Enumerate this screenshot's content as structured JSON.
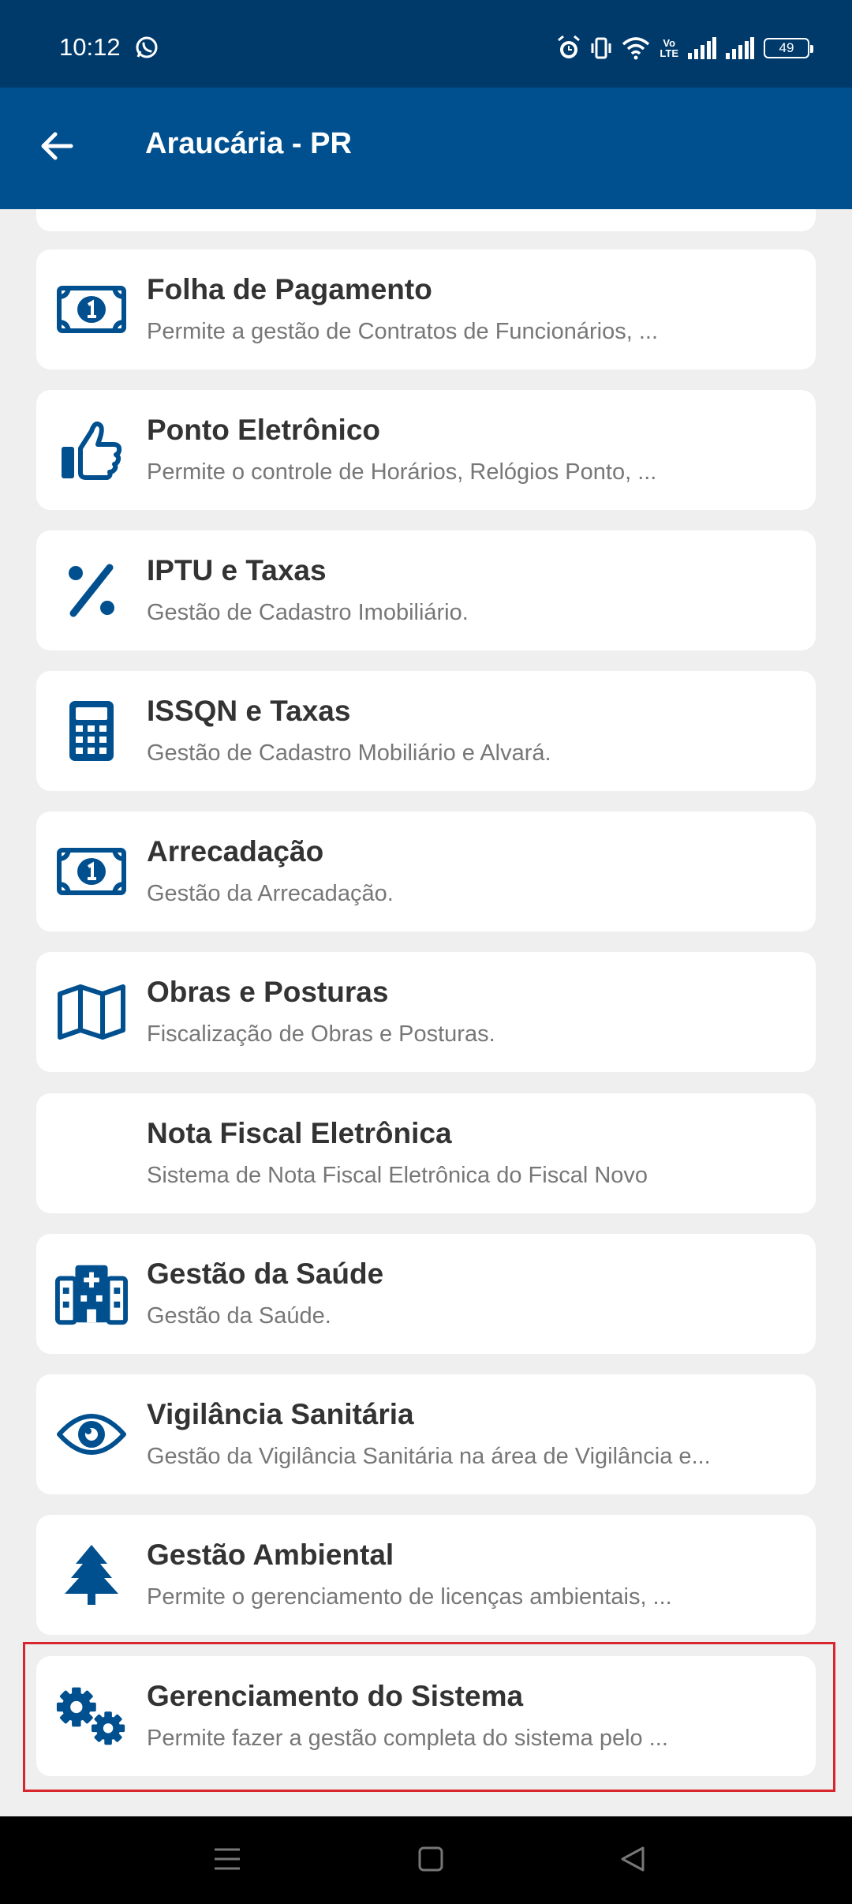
{
  "status_bar": {
    "time": "10:12",
    "battery": "49"
  },
  "app_bar": {
    "title": "Araucária - PR",
    "back_icon": "arrow-left-icon"
  },
  "colors": {
    "status_bar": "#003a6b",
    "app_bar": "#00508f",
    "icon": "#00508f",
    "highlight": "#d9262e",
    "background": "#efefef"
  },
  "modules": [
    {
      "title": "Folha de Pagamento",
      "desc": "Permite a gestão de Contratos de Funcionários, ...",
      "icon": "money-bill-icon"
    },
    {
      "title": "Ponto Eletrônico",
      "desc": "Permite o controle de Horários, Relógios Ponto, ...",
      "icon": "thumbs-up-icon"
    },
    {
      "title": "IPTU e Taxas",
      "desc": "Gestão de Cadastro Imobiliário.",
      "icon": "percent-icon"
    },
    {
      "title": "ISSQN e Taxas",
      "desc": "Gestão de Cadastro Mobiliário e Alvará.",
      "icon": "calculator-icon"
    },
    {
      "title": "Arrecadação",
      "desc": "Gestão da Arrecadação.",
      "icon": "money-bill-icon"
    },
    {
      "title": "Obras e Posturas",
      "desc": "Fiscalização de Obras e Posturas.",
      "icon": "map-icon"
    },
    {
      "title": "Nota Fiscal Eletrônica",
      "desc": "Sistema de Nota Fiscal Eletrônica do Fiscal Novo",
      "icon": "none"
    },
    {
      "title": "Gestão da Saúde",
      "desc": "Gestão da Saúde.",
      "icon": "hospital-icon"
    },
    {
      "title": "Vigilância Sanitária",
      "desc": "Gestão da Vigilância Sanitária na área de Vigilância e...",
      "icon": "eye-icon"
    },
    {
      "title": "Gestão Ambiental",
      "desc": "Permite o gerenciamento de licenças ambientais, ...",
      "icon": "tree-icon"
    },
    {
      "title": "Gerenciamento do Sistema",
      "desc": "Permite fazer a gestão completa do sistema pelo ...",
      "icon": "gears-icon"
    }
  ]
}
